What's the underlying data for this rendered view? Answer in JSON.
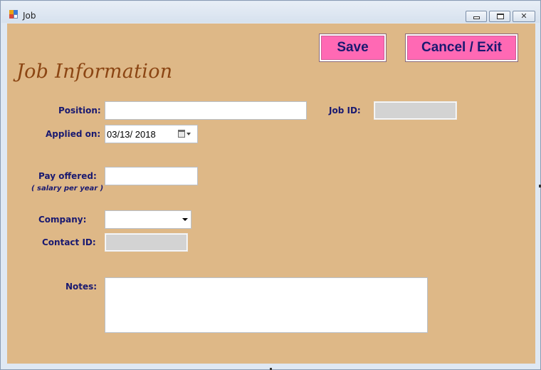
{
  "window": {
    "title": "Job",
    "icon": "app-icon",
    "controls": {
      "minimize": "minimize-icon",
      "maximize": "maximize-icon",
      "close": "close-icon"
    }
  },
  "colors": {
    "background": "#DEB887",
    "button": "#FF69B4",
    "label": "#191970",
    "heading": "#8B4513",
    "disabled_field": "#D3D3D3"
  },
  "toolbar": {
    "save_label": "Save",
    "cancel_label": "Cancel / Exit"
  },
  "form": {
    "heading": "Job Information",
    "position": {
      "label": "Position:",
      "value": ""
    },
    "job_id": {
      "label": "Job ID:",
      "value": ""
    },
    "applied_on": {
      "label": "Applied on:",
      "value": "03/13/ 2018"
    },
    "pay_offered": {
      "label": "Pay offered:",
      "sublabel": "( salary per year )",
      "value": ""
    },
    "company": {
      "label": "Company:",
      "value": ""
    },
    "contact_id": {
      "label": "Contact ID:",
      "value": ""
    },
    "notes": {
      "label": "Notes:",
      "value": ""
    }
  }
}
